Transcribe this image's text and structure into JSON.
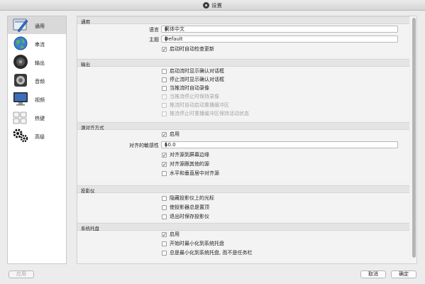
{
  "window": {
    "title": "设置"
  },
  "sidebar": {
    "items": [
      {
        "label": "通用",
        "icon": "settings-general-icon",
        "selected": true
      },
      {
        "label": "串流",
        "icon": "globe-icon",
        "selected": false
      },
      {
        "label": "输出",
        "icon": "speaker-icon",
        "selected": false
      },
      {
        "label": "音频",
        "icon": "audio-icon",
        "selected": false
      },
      {
        "label": "视频",
        "icon": "monitor-icon",
        "selected": false
      },
      {
        "label": "热键",
        "icon": "keyboard-icon",
        "selected": false
      },
      {
        "label": "高级",
        "icon": "gears-icon",
        "selected": false
      }
    ]
  },
  "general": {
    "header": "通用",
    "language_label": "语言",
    "language_value": "简体中文",
    "theme_label": "主题",
    "theme_value": "Default",
    "update_check_label": "启动时自动检查更新",
    "update_check_checked": true
  },
  "output": {
    "header": "输出",
    "options": [
      {
        "label": "启动流时显示确认对话框",
        "checked": false,
        "disabled": false
      },
      {
        "label": "停止流时显示确认对话框",
        "checked": false,
        "disabled": false
      },
      {
        "label": "当推流时自动录像",
        "checked": false,
        "disabled": false
      },
      {
        "label": "当推流停止时保持录像",
        "checked": false,
        "disabled": true
      },
      {
        "label": "推流时自动启动重播缓冲区",
        "checked": false,
        "disabled": true
      },
      {
        "label": "推流停止时重播缓冲区保持活动状态",
        "checked": false,
        "disabled": true
      }
    ]
  },
  "snapping": {
    "header": "源对齐方式",
    "enable_label": "启用",
    "enable_checked": true,
    "sensitivity_label": "对齐的敏感性",
    "sensitivity_value": "10.0",
    "options": [
      {
        "label": "对齐源到屏幕边缘",
        "checked": true
      },
      {
        "label": "对齐源跟其他的源",
        "checked": true
      },
      {
        "label": "水平和垂直居中对齐源",
        "checked": false
      }
    ]
  },
  "projector": {
    "header": "投影仪",
    "options": [
      {
        "label": "隐藏投影仪上的光标",
        "checked": false
      },
      {
        "label": "使投影器总是置顶",
        "checked": false
      },
      {
        "label": "退出时保存投影仪",
        "checked": false
      }
    ]
  },
  "tray": {
    "header": "系统托盘",
    "options": [
      {
        "label": "启用",
        "checked": true
      },
      {
        "label": "开始时最小化到系统托盘",
        "checked": false
      },
      {
        "label": "总是最小化到系统托盘, 而不是任务栏",
        "checked": false
      }
    ]
  },
  "buttons": {
    "apply": "应用",
    "cancel": "取消",
    "ok": "确定"
  },
  "check_mark": "✓"
}
